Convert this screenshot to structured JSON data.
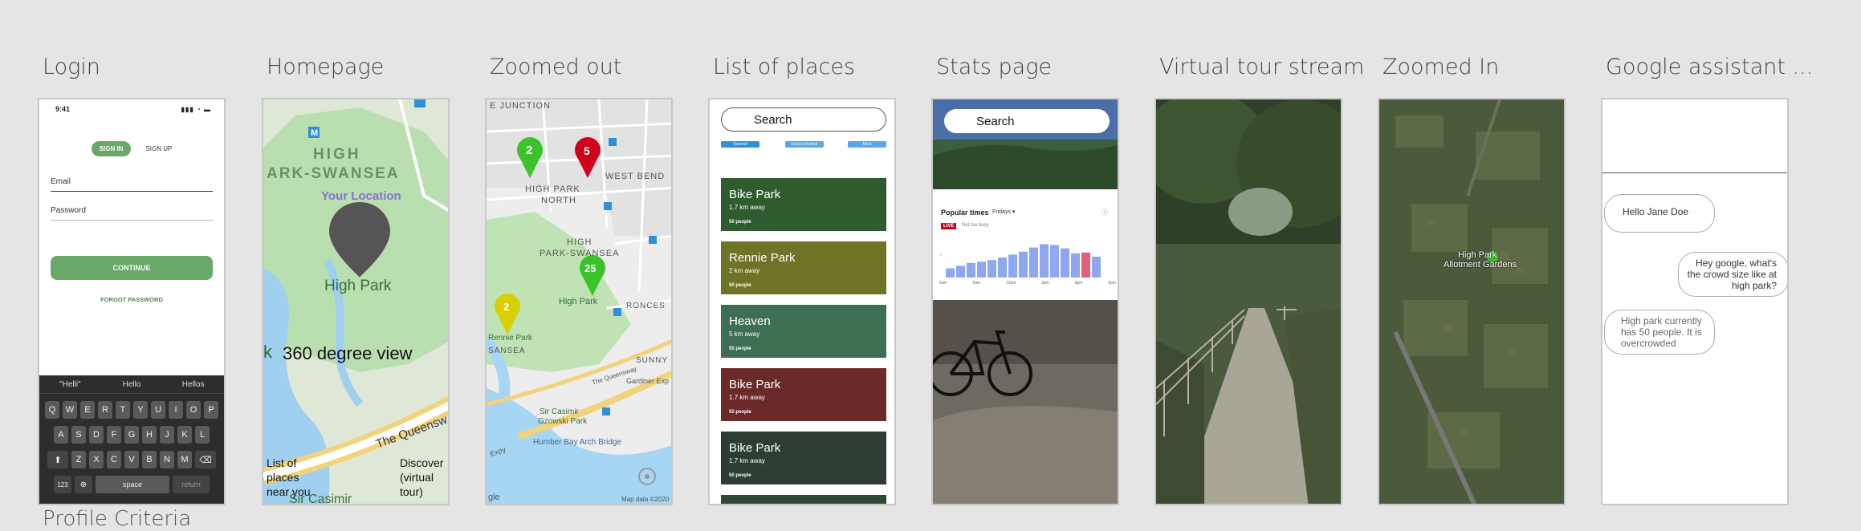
{
  "screens": {
    "login": {
      "title": "Login",
      "time": "9:41",
      "sign_in": "SIGN IN",
      "sign_up": "SIGN UP",
      "email": "Email",
      "password": "Password",
      "continue": "CONTINUE",
      "forgot": "FORGOT PASSWORD",
      "suggestions": [
        "\"Helli\"",
        "Hello",
        "Hellos"
      ],
      "row1": [
        "Q",
        "W",
        "E",
        "R",
        "T",
        "Y",
        "U",
        "I",
        "O",
        "P"
      ],
      "row2": [
        "A",
        "S",
        "D",
        "F",
        "G",
        "H",
        "J",
        "K",
        "L"
      ],
      "row3": [
        "Z",
        "X",
        "C",
        "V",
        "B",
        "N",
        "M"
      ],
      "key_123": "123",
      "key_space": "space",
      "key_return": "return"
    },
    "homepage": {
      "title": "Homepage",
      "area_line1": "HIGH",
      "area_line2": "ARK-SWANSEA",
      "your_location": "Your Location",
      "place": "High Park",
      "view_360": "360 degree view",
      "k_fragment": "k",
      "queensway": "The Queensw",
      "list_places": "List of places near you",
      "discover": "Discover (virtual tour)",
      "sir_casimir": "Sir Casimir"
    },
    "zoomed_out": {
      "title": "Zoomed out",
      "junction": "E JUNCTION",
      "high_park_north_1": "HIGH PARK",
      "high_park_north_2": "NORTH",
      "west_bend": "WEST BEND",
      "high_park_swansea_1": "HIGH",
      "high_park_swansea_2": "PARK-SWANSEA",
      "high_park": "High Park",
      "rennie_park": "Rennie Park",
      "sansea": "SANSEA",
      "roncesv": "RONCES",
      "sunny": "SUNNY",
      "sir_casimir_1": "Sir Casimir",
      "sir_casimir_2": "Gzowski Park",
      "humber_bridge": "Humber Bay Arch Bridge",
      "gardiner": "Gardiner Exp",
      "queensway": "The Queensway",
      "map_data": "Map data ©2020",
      "google": "gle",
      "expy": "Expy",
      "pin_green_1": "2",
      "pin_red": "5",
      "pin_green_2": "25",
      "pin_yellow": "2",
      "colors": {
        "green": "#3cc22b",
        "red": "#d0021b",
        "yellow": "#d8d000"
      }
    },
    "list_of_places": {
      "title": "List of places",
      "search": "Search",
      "chips": [
        "Nearest",
        "Least crowded",
        "Most"
      ],
      "cards": [
        {
          "name": "Bike Park",
          "dist": "1.7 km away",
          "people": "50 people",
          "color": "#2f5c2f"
        },
        {
          "name": "Rennie Park",
          "dist": "2 km away",
          "people": "50 people",
          "color": "#6f7326"
        },
        {
          "name": "Heaven",
          "dist": "5 km away",
          "people": "50 people",
          "color": "#3f6f52"
        },
        {
          "name": "Bike Park",
          "dist": "1.7 km away",
          "people": "50 people",
          "color": "#6b2a2a"
        },
        {
          "name": "Bike Park",
          "dist": "1.7 km away",
          "people": "50 people",
          "color": "#2d3d33"
        },
        {
          "name": "Bike Park",
          "dist": "",
          "people": "",
          "color": "#2e4a35"
        }
      ]
    },
    "stats": {
      "title": "Stats page",
      "search": "Search",
      "popular_times": "Popular times",
      "day": "Fridays",
      "live": "LIVE",
      "not_busy": "Not too busy",
      "xticks": [
        "6am",
        "9am",
        "12pm",
        "3pm",
        "6pm",
        "9pm"
      ],
      "bars": [
        0.22,
        0.28,
        0.35,
        0.38,
        0.42,
        0.48,
        0.55,
        0.62,
        0.72,
        0.8,
        0.78,
        0.7,
        0.58,
        0.6,
        0.5
      ],
      "live_index": 13,
      "bar_color": "#8fa6f0",
      "live_color": "#e0607e"
    },
    "virtual_tour": {
      "title": "Virtual tour stream"
    },
    "zoomed_in": {
      "title": "Zoomed In",
      "place_1": "High Park",
      "place_2": "Allotment Gardens"
    },
    "assistant": {
      "title": "Google assistant ...",
      "msg1": "Hello Jane Doe",
      "msg2": "Hey google, what's the crowd size like at high park?",
      "msg3": "High park currently has 50 people. It is overcrowded"
    }
  },
  "bottom_label": "Profile Criteria"
}
